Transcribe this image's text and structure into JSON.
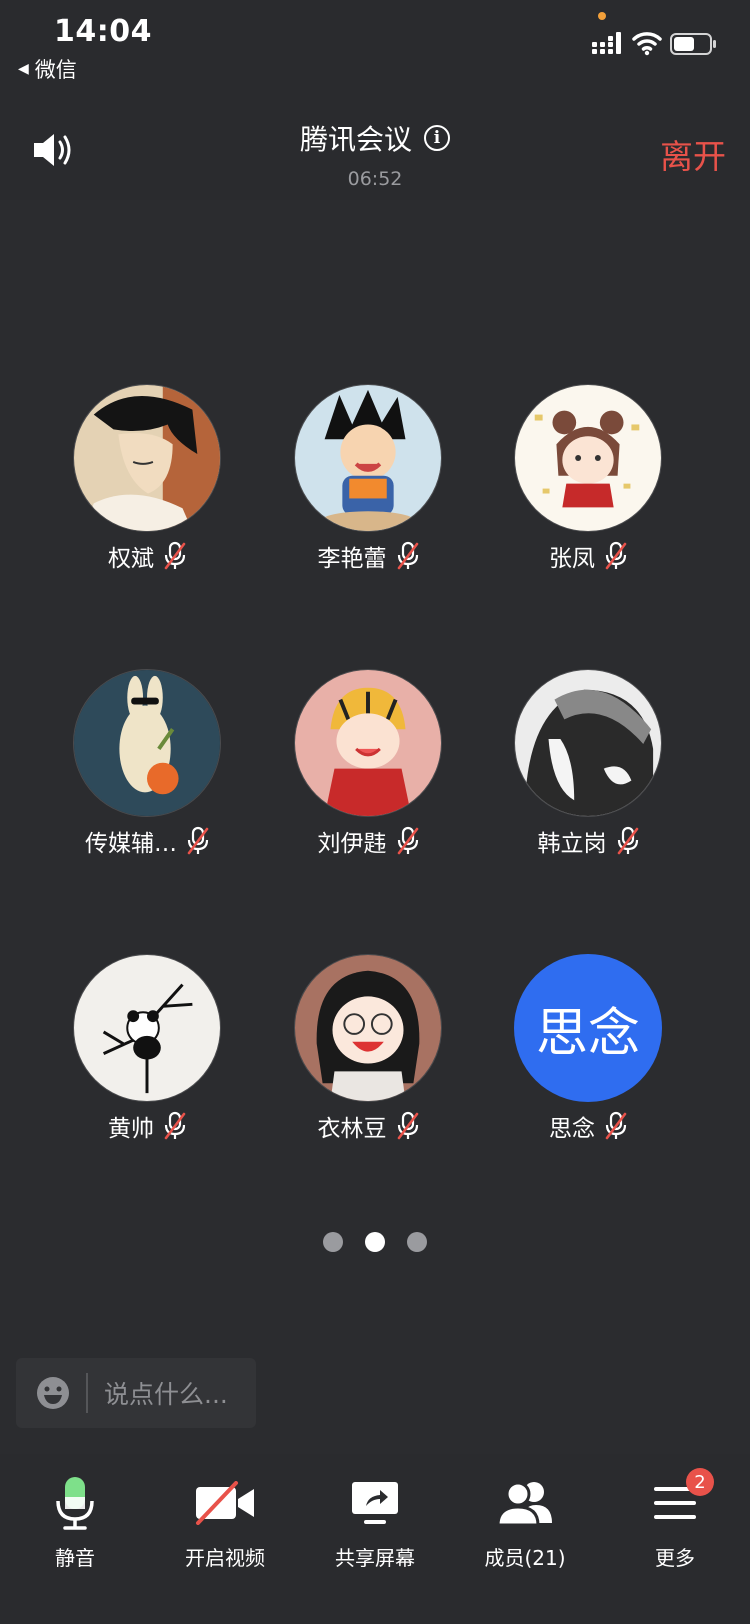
{
  "statusbar": {
    "time": "14:04",
    "back_app": "微信"
  },
  "header": {
    "title": "腾讯会议",
    "duration": "06:52",
    "leave_label": "离开"
  },
  "members": [
    {
      "name": "权斌",
      "muted": true
    },
    {
      "name": "李艳蕾",
      "muted": true
    },
    {
      "name": "张凤",
      "muted": true
    },
    {
      "name": "传媒辅…",
      "muted": true
    },
    {
      "name": "刘伊韪",
      "muted": true
    },
    {
      "name": "韩立岗",
      "muted": true
    },
    {
      "name": "黄帅",
      "muted": true
    },
    {
      "name": "衣林豆",
      "muted": true
    },
    {
      "name": "思念",
      "muted": true,
      "avatar_text": "思念",
      "avatar_color": "#2f6df0"
    }
  ],
  "pager": {
    "total": 3,
    "current": 2
  },
  "chat": {
    "placeholder": "说点什么..."
  },
  "toolbar": {
    "mute_label": "静音",
    "video_label": "开启视频",
    "share_label": "共享屏幕",
    "members_label": "成员(21)",
    "more_label": "更多",
    "more_badge": "2"
  },
  "colors": {
    "accent_red": "#e8524a",
    "mic_green": "#7ee08a",
    "avatar_blue": "#2f6df0"
  }
}
